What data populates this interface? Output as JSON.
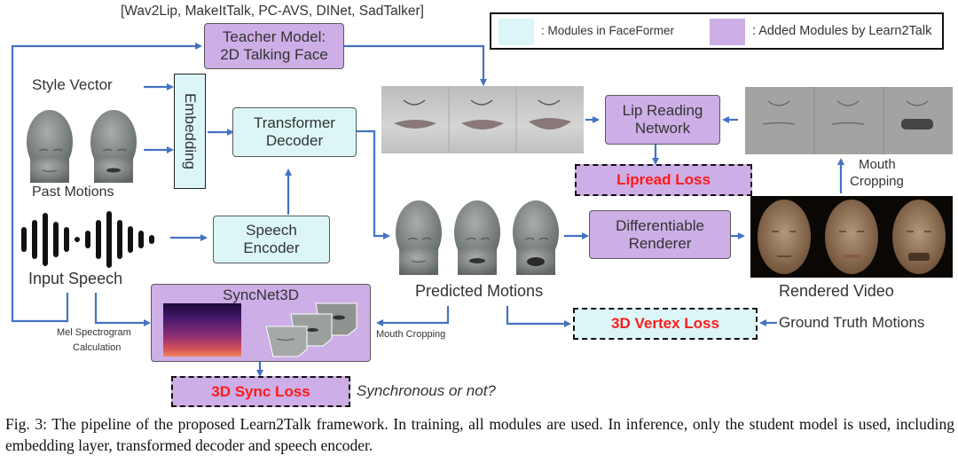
{
  "teacher": {
    "models_list": "[Wav2Lip, MakeItTalk, PC-AVS, DINet, SadTalker]",
    "line1": "Teacher Model:",
    "line2": "2D Talking Face"
  },
  "legend": {
    "items": [
      {
        "label": ": Modules in FaceFormer",
        "color": "#dcf6f7"
      },
      {
        "label": ": Added Modules by Learn2Talk",
        "color": "#cdaee6"
      }
    ]
  },
  "inputs": {
    "style_vector": "Style Vector",
    "past_motions": "Past Motions",
    "input_speech": "Input Speech"
  },
  "modules": {
    "embedding": "Embedding",
    "transformer_line1": "Transformer",
    "transformer_line2": "Decoder",
    "speech_encoder_line1": "Speech",
    "speech_encoder_line2": "Encoder",
    "lip_reading_line1": "Lip Reading",
    "lip_reading_line2": "Network",
    "renderer_line1": "Differentiable",
    "renderer_line2": "Renderer",
    "syncnet": "SyncNet3D"
  },
  "labels": {
    "predicted_motions": "Predicted Motions",
    "rendered_video": "Rendered Video",
    "mouth_cropping_top_line1": "Mouth",
    "mouth_cropping_top_line2": "Cropping",
    "mouth_cropping_bottom": "Mouth Cropping",
    "mel_line1": "Mel Spectrogram",
    "mel_line2": "Calculation",
    "ground_truth": "Ground Truth Motions",
    "synchronous": "Synchronous or not?"
  },
  "losses": {
    "lipread": "Lipread Loss",
    "vertex": "3D Vertex Loss",
    "sync": "3D Sync Loss"
  },
  "colors": {
    "arrow": "#4472c4",
    "loss_text": "#ff1a1a",
    "purple": "#cdaee6",
    "cyan": "#dcf6f7"
  },
  "caption": "Fig. 3: The pipeline of the proposed Learn2Talk framework. In training, all modules are used. In inference, only the student model is used, including embedding layer, transformed decoder and speech encoder."
}
